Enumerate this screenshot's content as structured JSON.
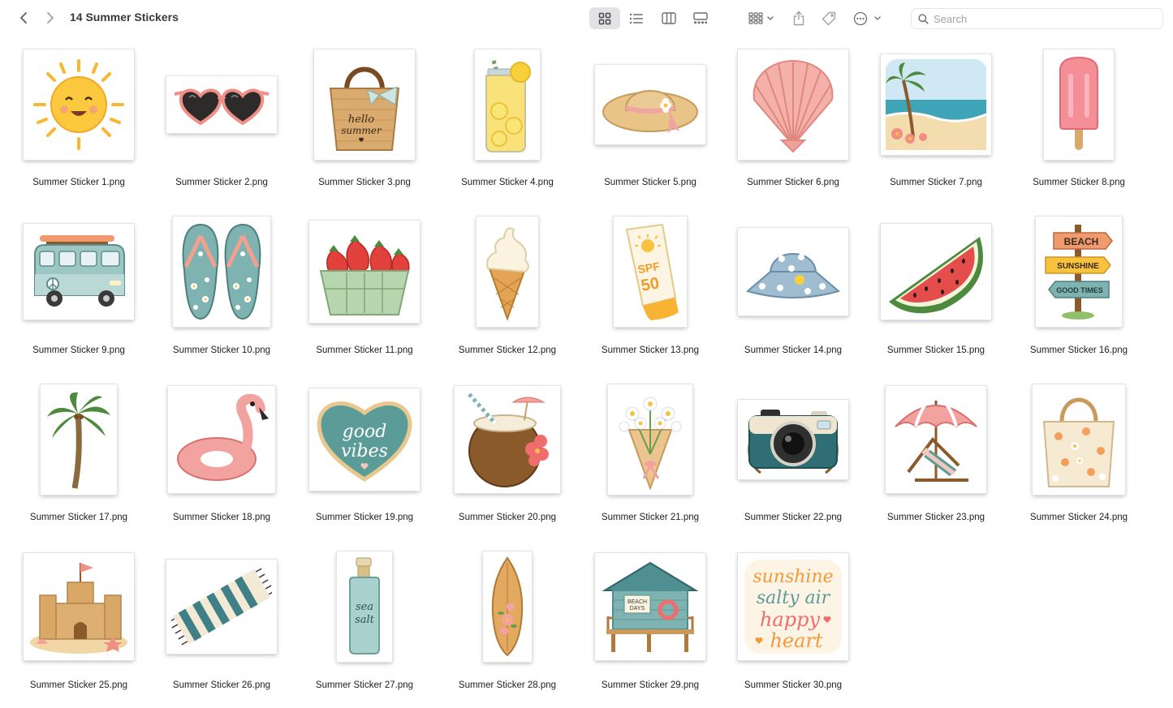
{
  "window": {
    "title": "14 Summer Stickers"
  },
  "toolbar": {
    "back_icon": "chevron-left-icon",
    "forward_icon": "chevron-right-icon",
    "views": [
      "icon-view-icon",
      "list-view-icon",
      "column-view-icon",
      "gallery-view-icon"
    ],
    "active_view": "icon-view-icon",
    "group_icon": "group-by-icon",
    "share_icon": "share-icon",
    "tag_icon": "tag-icon",
    "more_icon": "more-actions-icon"
  },
  "search": {
    "placeholder": "Search",
    "value": ""
  },
  "files": [
    {
      "name": "Summer Sticker 1.png",
      "icon": "sun"
    },
    {
      "name": "Summer Sticker 2.png",
      "icon": "heart-sunglasses"
    },
    {
      "name": "Summer Sticker 3.png",
      "icon": "tote-bag",
      "text": "hello summer"
    },
    {
      "name": "Summer Sticker 4.png",
      "icon": "lemonade-jar"
    },
    {
      "name": "Summer Sticker 5.png",
      "icon": "straw-hat"
    },
    {
      "name": "Summer Sticker 6.png",
      "icon": "seashell"
    },
    {
      "name": "Summer Sticker 7.png",
      "icon": "beach-scene"
    },
    {
      "name": "Summer Sticker 8.png",
      "icon": "popsicle"
    },
    {
      "name": "Summer Sticker 9.png",
      "icon": "camper-van"
    },
    {
      "name": "Summer Sticker 10.png",
      "icon": "flip-flops"
    },
    {
      "name": "Summer Sticker 11.png",
      "icon": "strawberries"
    },
    {
      "name": "Summer Sticker 12.png",
      "icon": "ice-cream-cone"
    },
    {
      "name": "Summer Sticker 13.png",
      "icon": "sunscreen",
      "text": "SPF 50"
    },
    {
      "name": "Summer Sticker 14.png",
      "icon": "bucket-hat"
    },
    {
      "name": "Summer Sticker 15.png",
      "icon": "watermelon"
    },
    {
      "name": "Summer Sticker 16.png",
      "icon": "signpost",
      "text": [
        "BEACH",
        "SUNSHINE",
        "GOOD TIMES"
      ]
    },
    {
      "name": "Summer Sticker 17.png",
      "icon": "palm-tree"
    },
    {
      "name": "Summer Sticker 18.png",
      "icon": "flamingo-float"
    },
    {
      "name": "Summer Sticker 19.png",
      "icon": "heart-badge",
      "text": "good vibes"
    },
    {
      "name": "Summer Sticker 20.png",
      "icon": "coconut-drink"
    },
    {
      "name": "Summer Sticker 21.png",
      "icon": "flower-bouquet"
    },
    {
      "name": "Summer Sticker 22.png",
      "icon": "camera"
    },
    {
      "name": "Summer Sticker 23.png",
      "icon": "beach-umbrella-chair"
    },
    {
      "name": "Summer Sticker 24.png",
      "icon": "floral-tote"
    },
    {
      "name": "Summer Sticker 25.png",
      "icon": "sandcastle"
    },
    {
      "name": "Summer Sticker 26.png",
      "icon": "beach-towel"
    },
    {
      "name": "Summer Sticker 27.png",
      "icon": "sea-salt-spray",
      "text": "sea salt"
    },
    {
      "name": "Summer Sticker 28.png",
      "icon": "surfboard"
    },
    {
      "name": "Summer Sticker 29.png",
      "icon": "beach-hut",
      "text": "BEACH DAYS"
    },
    {
      "name": "Summer Sticker 30.png",
      "icon": "quote",
      "text": [
        "sunshine",
        "salty air",
        "happy",
        "heart"
      ]
    }
  ],
  "colors": {
    "coral": "#ef8f86",
    "pink": "#f4a8a8",
    "teal": "#7fb3b1",
    "sand": "#d9b37a",
    "yellow": "#f7c23e",
    "green": "#4e8a3e",
    "brown": "#8b5a2b"
  }
}
